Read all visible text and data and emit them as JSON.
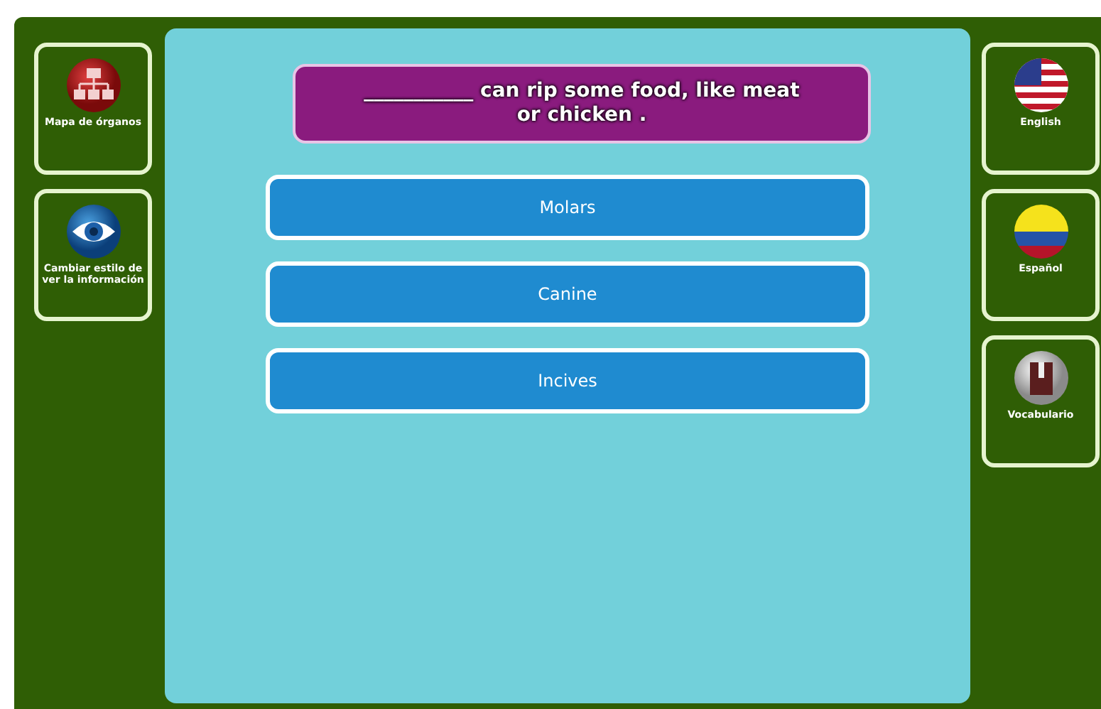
{
  "left_sidebar": [
    {
      "label": "Mapa de órganos"
    },
    {
      "label": "Cambiar estilo de ver la información"
    }
  ],
  "question": {
    "text": "___________ can rip some food, like meat or chicken ."
  },
  "answers": [
    {
      "label": "Molars"
    },
    {
      "label": "Canine"
    },
    {
      "label": "Incives"
    }
  ],
  "right_sidebar": [
    {
      "label": "English"
    },
    {
      "label": "Español"
    },
    {
      "label": "Vocabulario"
    }
  ]
}
